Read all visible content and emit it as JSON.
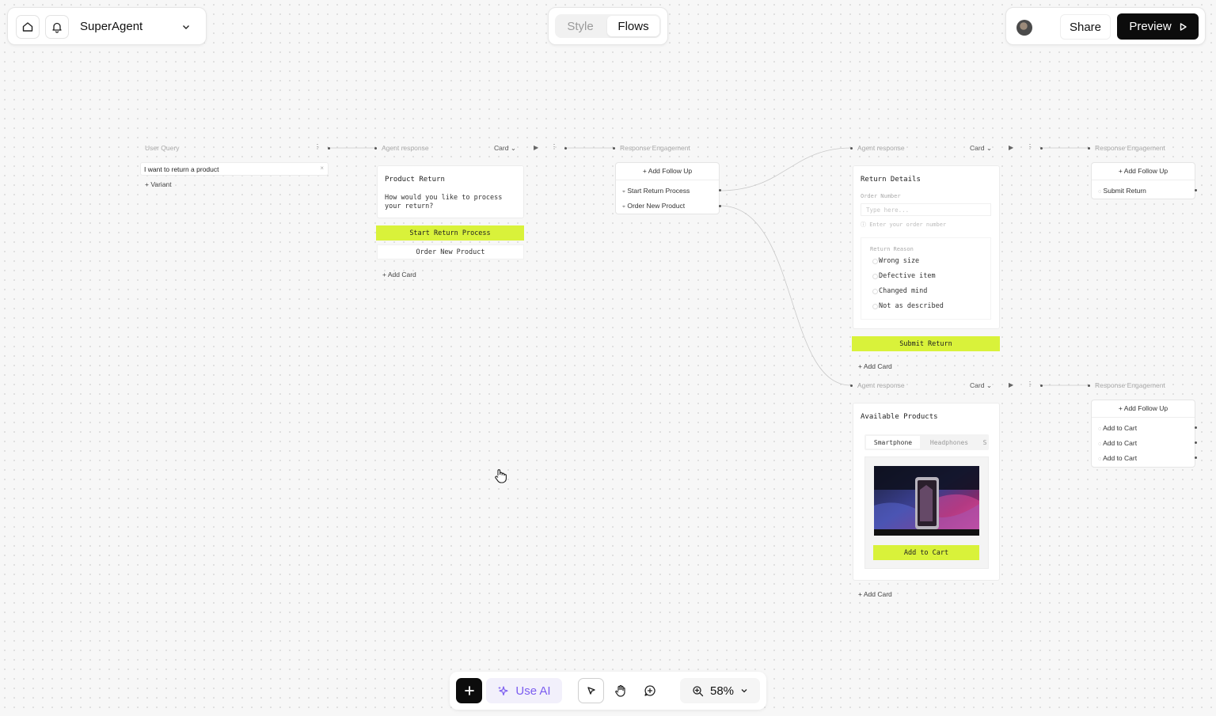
{
  "topbar": {
    "app_name": "SuperAgent",
    "tabs": [
      {
        "label": "Style"
      },
      {
        "label": "Flows"
      }
    ],
    "share_label": "Share",
    "preview_label": "Preview"
  },
  "flow": {
    "user_query": {
      "label": "User Query",
      "input_value": "I want to return a product",
      "variant_label": "Variant"
    },
    "agent_response_1": {
      "label": "Agent response",
      "type": "Card",
      "card_title": "Product Return",
      "card_text": "How would you like to process your return?",
      "buttons": [
        "Start Return Process",
        "Order New Product"
      ],
      "add_card": "Add Card"
    },
    "engagement_1": {
      "label": "Response Engagement",
      "add_follow_up": "Add Follow Up",
      "items": [
        "Start Return Process",
        "Order New Product"
      ]
    },
    "agent_response_2": {
      "label": "Agent response",
      "type": "Card",
      "card_title": "Return Details",
      "order_label": "Order Number",
      "order_placeholder": "Type here...",
      "order_hint": "Enter your order number",
      "reason_label": "Return Reason",
      "reasons": [
        "Wrong size",
        "Defective item",
        "Changed mind",
        "Not as described"
      ],
      "submit": "Submit Return",
      "add_card": "Add Card"
    },
    "engagement_2": {
      "label": "Response Engagement",
      "add_follow_up": "Add Follow Up",
      "items": [
        "Submit Return"
      ]
    },
    "agent_response_3": {
      "label": "Agent response",
      "type": "Card",
      "card_title": "Available Products",
      "tabs": [
        "Smartphone",
        "Headphones",
        "S"
      ],
      "add_to_cart": "Add to Cart",
      "add_card": "Add Card"
    },
    "engagement_3": {
      "label": "Response Engagement",
      "add_follow_up": "Add Follow Up",
      "items": [
        "Add to Cart",
        "Add to Cart",
        "Add to Cart"
      ]
    }
  },
  "toolbar": {
    "use_ai_label": "Use AI",
    "zoom": "58%"
  },
  "colors": {
    "accent_lime": "#d9f23a",
    "dark": "#0c0c0c",
    "ai_purple": "#7b5cf0"
  }
}
